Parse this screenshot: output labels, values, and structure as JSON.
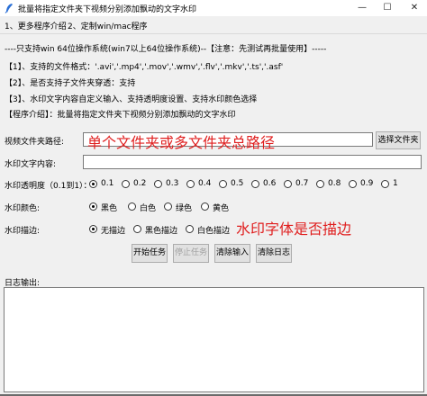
{
  "window": {
    "title": "批量将指定文件夹下视频分别添加飘动的文字水印",
    "min_symbol": "—",
    "max_symbol": "☐",
    "close_symbol": "✕"
  },
  "menu": {
    "items": [
      "1、更多程序介绍",
      "2、定制win/mac程序"
    ]
  },
  "info": {
    "lines": [
      "----只支持win 64位操作系统(win7以上64位操作系统)--【注意：先测试再批量使用】-----",
      "【1】、支持的文件格式：'.avi','.mp4','.mov','.wmv','.flv','.mkv','.ts','.asf'",
      "【2】、是否支持子文件夹穿透：支持",
      "【3】、水印文字内容自定义输入、支持透明度设置、支持水印颜色选择",
      "【程序介绍】：批量将指定文件夹下视频分别添加飘动的文字水印"
    ]
  },
  "form": {
    "folder_label": "视频文件夹路径:",
    "folder_value": "",
    "folder_hint": "单个文件夹或多文件夹总路径",
    "choose_folder_button": "选择文件夹",
    "watermark_text_label": "水印文字内容:",
    "watermark_text_value": "",
    "opacity_label": "水印透明度（0.1到1）：",
    "opacity_options": [
      "0.1",
      "0.2",
      "0.3",
      "0.4",
      "0.5",
      "0.6",
      "0.7",
      "0.8",
      "0.9",
      "1"
    ],
    "opacity_selected": "0.1",
    "color_label": "水印颜色:",
    "color_options": [
      "黑色",
      "白色",
      "绿色",
      "黄色"
    ],
    "color_selected": "黑色",
    "stroke_label": "水印描边:",
    "stroke_options": [
      "无描边",
      "黑色描边",
      "白色描边"
    ],
    "stroke_selected": "无描边",
    "stroke_hint": "水印字体是否描边",
    "buttons": {
      "start": "开始任务",
      "stop": "停止任务",
      "clear_input": "清除输入",
      "clear_log": "清除日志"
    },
    "log_label": "日志输出:",
    "log_value": ""
  }
}
